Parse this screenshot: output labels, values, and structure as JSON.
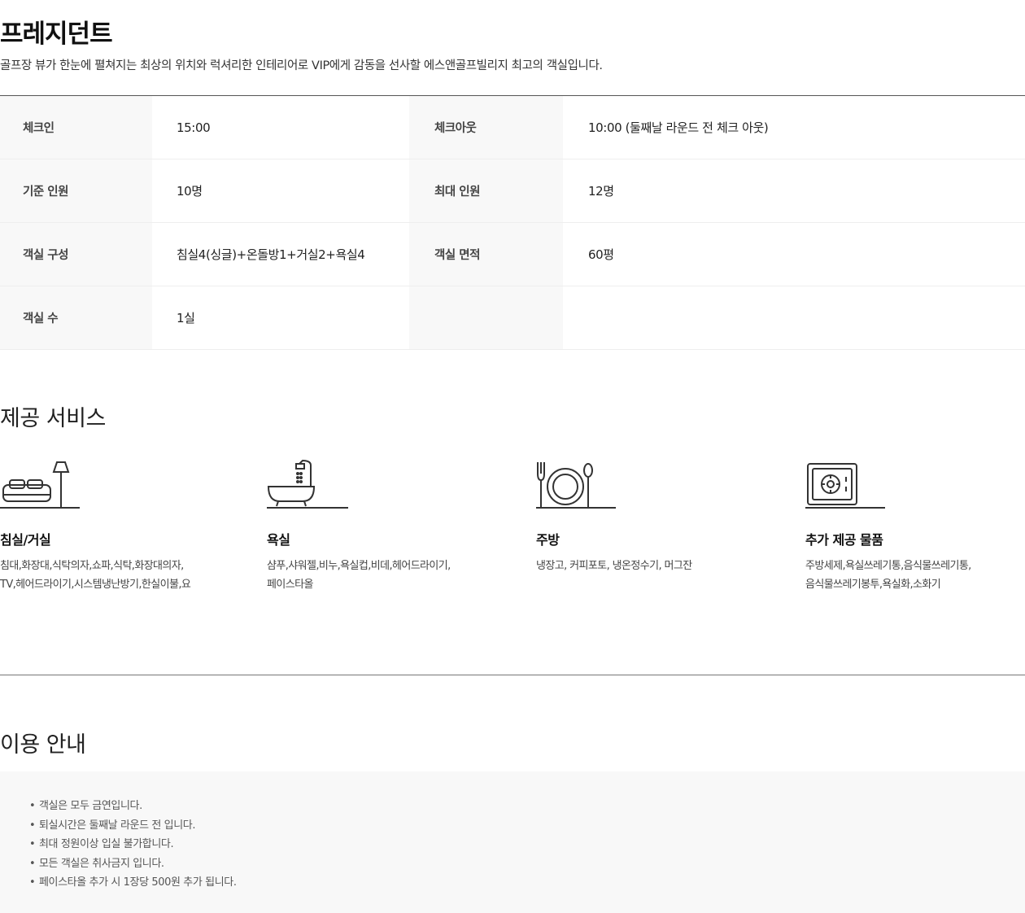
{
  "room": {
    "title": "프레지던트",
    "subtitle": "골프장 뷰가 한눈에 펼쳐지는 최상의 위치와 럭셔리한 인테리어로 VIP에게 감동을 선사할 에스앤골프빌리지 최고의 객실입니다."
  },
  "info": {
    "rows": [
      {
        "label1": "체크인",
        "value1": "15:00",
        "label2": "체크아웃",
        "value2": "10:00 (둘째날 라운드 전 체크 아웃)"
      },
      {
        "label1": "기준 인원",
        "value1": "10명",
        "label2": "최대 인원",
        "value2": "12명"
      },
      {
        "label1": "객실 구성",
        "value1": "침실4(싱글)+온돌방1+거실2+욕실4",
        "label2": "객실 면적",
        "value2": "60평"
      },
      {
        "label1": "객실 수",
        "value1": "1실",
        "label2": "",
        "value2": ""
      }
    ]
  },
  "services": {
    "heading": "제공 서비스",
    "items": [
      {
        "icon": "bed-lamp-icon",
        "title": "침실/거실",
        "desc_line1": "침대,화장대,식탁의자,쇼파,식탁,화장대의자,",
        "desc_line2": "TV,헤어드라이기,시스템냉난방기,한실이불,요"
      },
      {
        "icon": "bathtub-icon",
        "title": "욕실",
        "desc_line1": "샴푸,샤워젤,비누,욕실컵,비데,헤어드라이기,",
        "desc_line2": "페이스타올"
      },
      {
        "icon": "dining-plate-icon",
        "title": "주방",
        "desc_line1": "냉장고, 커피포토, 냉온정수기, 머그잔",
        "desc_line2": ""
      },
      {
        "icon": "safe-icon",
        "title": "추가 제공 물품",
        "desc_line1": "주방세제,욕실쓰레기통,음식물쓰레기통,",
        "desc_line2": "음식물쓰레기봉투,욕실화,소화기"
      }
    ]
  },
  "notice": {
    "heading": "이용 안내",
    "bullet": "•",
    "items": [
      "객실은 모두 금연입니다.",
      "퇴실시간은  둘째날 라운드 전 입니다.",
      "최대 정원이상 입실 불가합니다.",
      "모든 객실은 취사금지 입니다.",
      "페이스타올 추가 시 1장당 500원 추가 됩니다."
    ]
  }
}
